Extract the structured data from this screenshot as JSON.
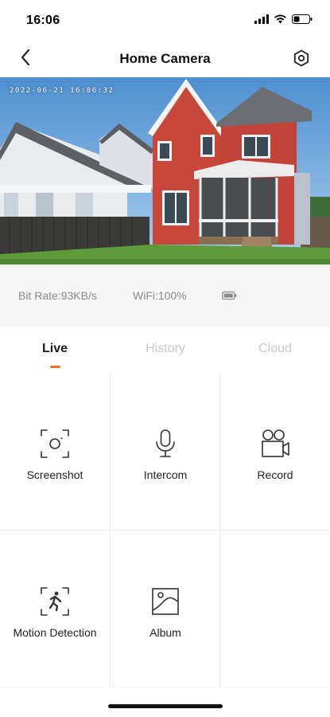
{
  "status_bar": {
    "time": "16:06",
    "icons": [
      "signal-icon",
      "wifi-icon",
      "battery-icon"
    ]
  },
  "nav": {
    "title": "Home Camera",
    "back_icon": "chevron-left-icon",
    "settings_icon": "settings-icon"
  },
  "video": {
    "timestamp": "2022-06-21  16:06:32"
  },
  "info": {
    "bit_rate": "Bit Rate:93KB/s",
    "wifi": "WiFi:100%",
    "battery_icon": "battery-icon"
  },
  "tabs": [
    {
      "label": "Live",
      "active": true
    },
    {
      "label": "History",
      "active": false
    },
    {
      "label": "Cloud",
      "active": false
    }
  ],
  "actions": [
    {
      "label": "Screenshot",
      "icon": "screenshot-icon"
    },
    {
      "label": "Intercom",
      "icon": "microphone-icon"
    },
    {
      "label": "Record",
      "icon": "video-camera-icon"
    },
    {
      "label": "Motion Detection",
      "icon": "motion-detection-icon"
    },
    {
      "label": "Album",
      "icon": "album-icon"
    }
  ],
  "colors": {
    "accent": "#ff6a2b",
    "tab_inactive": "#c8c8c8",
    "info_text": "#8a8a8a"
  }
}
